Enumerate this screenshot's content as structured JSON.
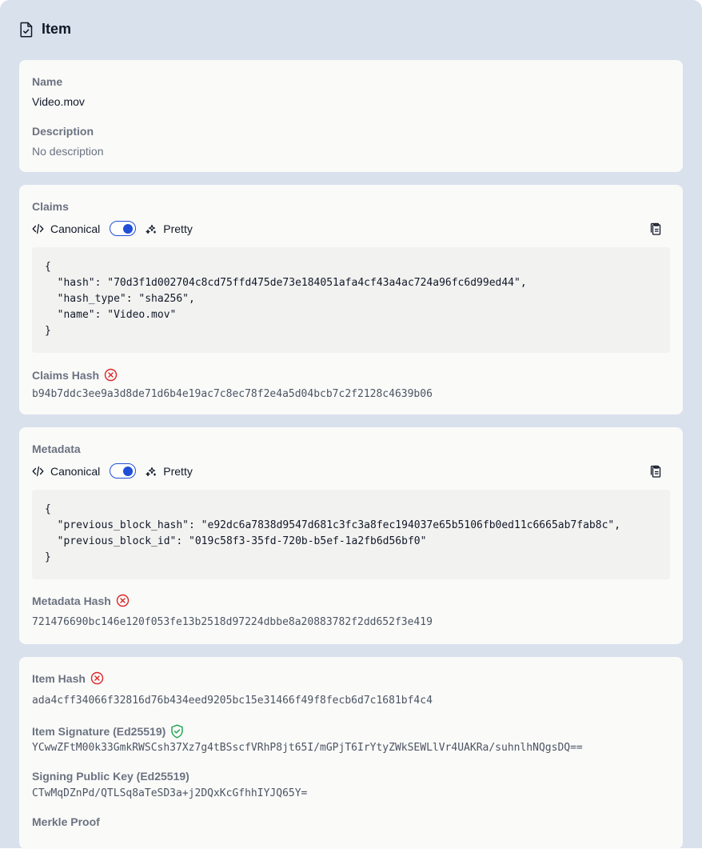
{
  "header": {
    "title": "Item",
    "icon": "file-check-icon"
  },
  "item_info": {
    "name_label": "Name",
    "name_value": "Video.mov",
    "description_label": "Description",
    "description_value": "No description"
  },
  "claims": {
    "title": "Claims",
    "canonical_label": "Canonical",
    "pretty_label": "Pretty",
    "toggle_on": true,
    "code_lines": [
      "{",
      "  \"hash\": \"70d3f1d002704c8cd75ffd475de73e184051afa4cf43a4ac724a96fc6d99ed44\",",
      "  \"hash_type\": \"sha256\",",
      "  \"name\": \"Video.mov\"",
      "}"
    ],
    "hash_label": "Claims Hash",
    "hash_status": "invalid",
    "hash_value": "b94b7ddc3ee9a3d8de71d6b4e19ac7c8ec78f2e4a5d04bcb7c2f2128c4639b06"
  },
  "metadata": {
    "title": "Metadata",
    "canonical_label": "Canonical",
    "pretty_label": "Pretty",
    "toggle_on": true,
    "code_lines": [
      "{",
      "  \"previous_block_hash\": \"e92dc6a7838d9547d681c3fc3a8fec194037e65b5106fb0ed11c6665ab7fab8c\",",
      "  \"previous_block_id\": \"019c58f3-35fd-720b-b5ef-1a2fb6d56bf0\"",
      "}"
    ],
    "hash_label": "Metadata Hash",
    "hash_status": "invalid",
    "hash_value": "721476690bc146e120f053fe13b2518d97224dbbe8a20883782f2dd652f3e419"
  },
  "signatures": {
    "item_hash_label": "Item Hash",
    "item_hash_status": "invalid",
    "item_hash_value": "ada4cff34066f32816d76b434eed9205bc15e31466f49f8fecb6d7c1681bf4c4",
    "signature_label": "Item Signature (Ed25519)",
    "signature_status": "verified",
    "signature_value": "YCwwZFtM00k33GmkRWSCsh37Xz7g4tBSscfVRhP8jt65I/mGPjT6IrYtyZWkSEWLlVr4UAKRa/suhnlhNQgsDQ==",
    "public_key_label": "Signing Public Key (Ed25519)",
    "public_key_value": "CTwMqDZnPd/QTLSq8aTeSD3a+j2DQxKcGfhhIYJQ65Y=",
    "merkle_label": "Merkle Proof"
  },
  "colors": {
    "background": "#d9e1ec",
    "card": "#fafaf9",
    "accent": "#1f4fd6",
    "error": "#dc2626",
    "success": "#16a34a"
  }
}
